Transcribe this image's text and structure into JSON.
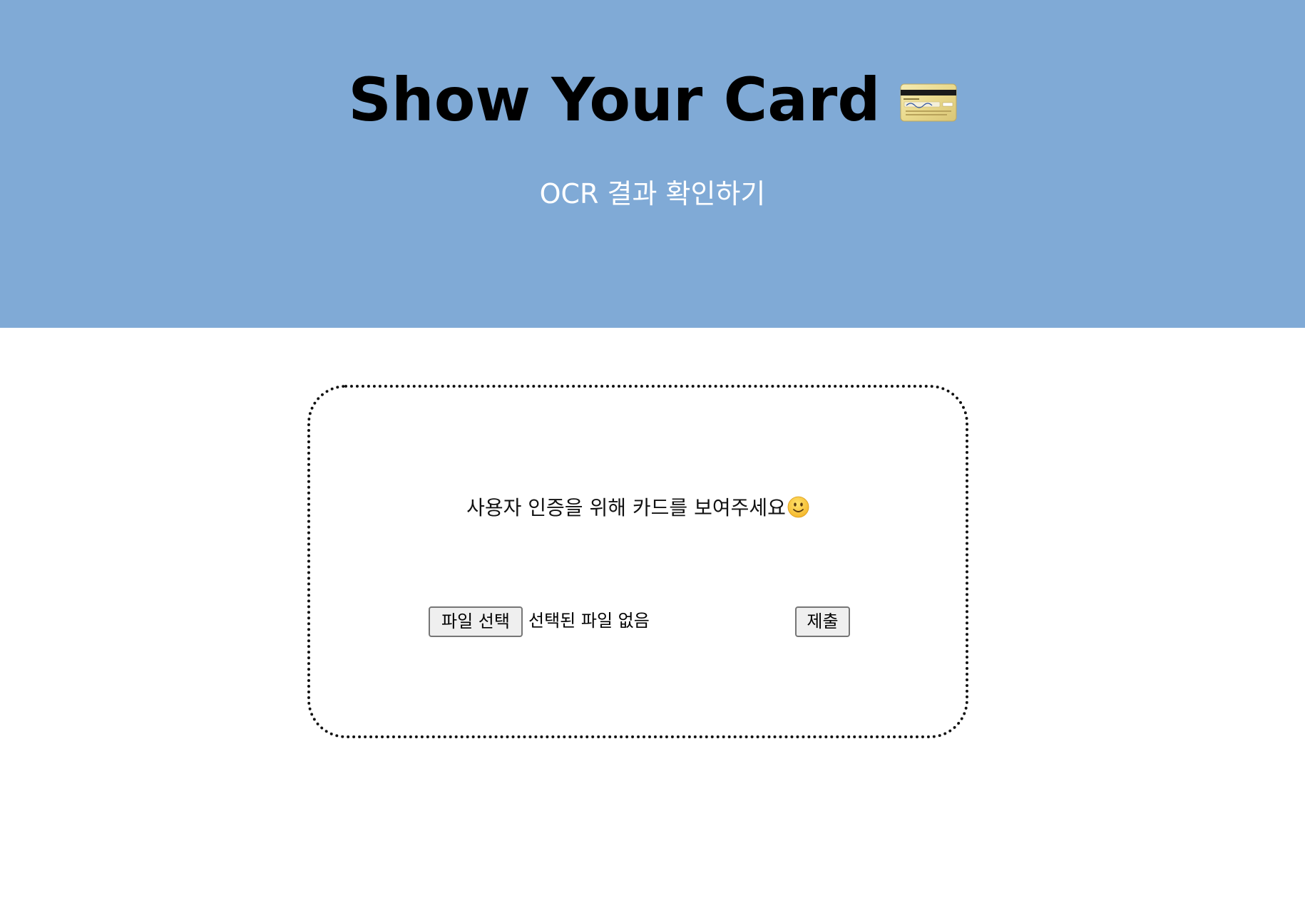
{
  "header": {
    "title": "Show Your Card",
    "title_icon": "credit-card-icon",
    "subtitle": "OCR 결과 확인하기",
    "background_color": "#80aad6"
  },
  "upload": {
    "prompt": "사용자 인증을 위해 카드를 보여주세요",
    "prompt_icon": "smiling-face-icon",
    "file_button_label": "파일 선택",
    "file_status": "선택된 파일 없음",
    "submit_label": "제출"
  }
}
